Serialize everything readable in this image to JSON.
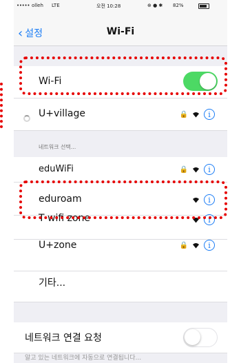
{
  "status_bar": {
    "signal": "•••••",
    "carrier": "olleh",
    "network": "LTE",
    "time": "오전 10:28",
    "battery": "82%"
  },
  "nav": {
    "back_label": "설정",
    "title": "Wi-Fi"
  },
  "wifi_toggle": {
    "label": "Wi-Fi",
    "on": true
  },
  "connected_network": {
    "name": "U+village",
    "secured": true
  },
  "section_header": "네트워크 선택...",
  "networks": [
    {
      "name": "eduWiFi",
      "secured": true
    },
    {
      "name": "eduroam",
      "secured": false
    },
    {
      "name": "T wifi zone",
      "secured": false
    },
    {
      "name": "U+zone",
      "secured": true
    }
  ],
  "other_label": "기타...",
  "ask_to_join": {
    "label": "네트워크 연결 요청",
    "on": false
  },
  "footer": "알고 있는 네트워크에 자동으로 연결됩니다...",
  "colors": {
    "accent": "#1a7cf5",
    "toggle_on": "#4cd964",
    "highlight": "#e60000"
  }
}
